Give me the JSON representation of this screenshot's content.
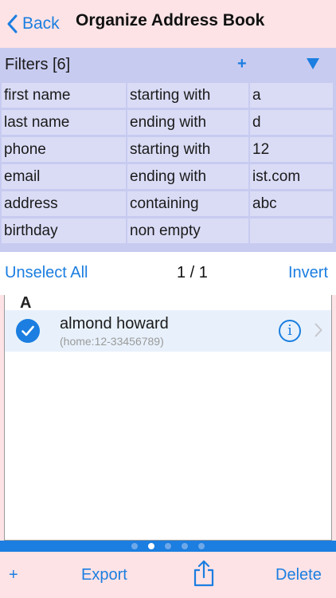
{
  "nav": {
    "back_label": "Back",
    "title": "Organize Address Book"
  },
  "filters": {
    "title": "Filters [6]",
    "add_label": "+",
    "rows": [
      {
        "field": "first name",
        "op": "starting with",
        "value": "a"
      },
      {
        "field": "last name",
        "op": "ending with",
        "value": "d"
      },
      {
        "field": "phone",
        "op": "starting with",
        "value": "12"
      },
      {
        "field": "email",
        "op": "ending with",
        "value": "ist.com"
      },
      {
        "field": "address",
        "op": "containing",
        "value": "abc"
      },
      {
        "field": "birthday",
        "op": "non empty",
        "value": ""
      }
    ]
  },
  "selection": {
    "unselect_label": "Unselect All",
    "counter": "1 / 1",
    "invert_label": "Invert"
  },
  "list": {
    "section": "A",
    "contacts": [
      {
        "name": "almond howard",
        "detail": "(home:12-33456789)",
        "selected": true
      }
    ]
  },
  "pager": {
    "count": 5,
    "active": 1
  },
  "toolbar": {
    "add_label": "+",
    "export_label": "Export",
    "delete_label": "Delete"
  },
  "colors": {
    "accent": "#1b7ee0",
    "background": "#fde3e6",
    "filter_panel": "#c8cbf0",
    "filter_cell": "#dadcf6"
  }
}
